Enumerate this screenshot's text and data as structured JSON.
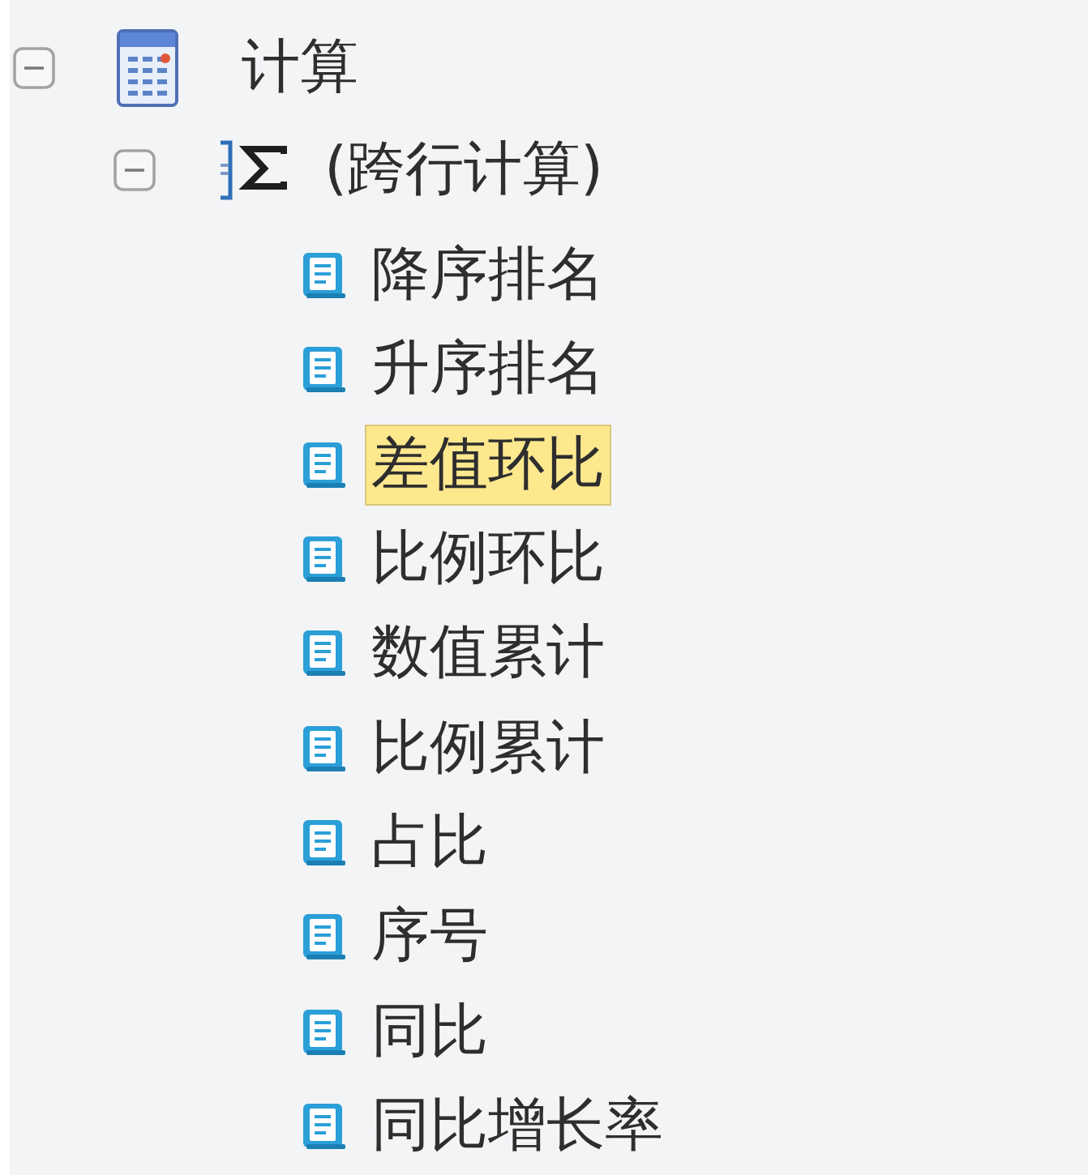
{
  "tree": [
    {
      "kind": "table",
      "label": "计算",
      "expanded": true,
      "selected": false,
      "children": [
        {
          "kind": "group",
          "label": "(跨行计算)",
          "expanded": true,
          "selected": false,
          "children": [
            {
              "kind": "field",
              "label": "降序排名",
              "selected": false
            },
            {
              "kind": "field",
              "label": "升序排名",
              "selected": false
            },
            {
              "kind": "field",
              "label": "差值环比",
              "selected": true
            },
            {
              "kind": "field",
              "label": "比例环比",
              "selected": false
            },
            {
              "kind": "field",
              "label": "数值累计",
              "selected": false
            },
            {
              "kind": "field",
              "label": "比例累计",
              "selected": false
            },
            {
              "kind": "field",
              "label": "占比",
              "selected": false
            },
            {
              "kind": "field",
              "label": "序号",
              "selected": false
            },
            {
              "kind": "field",
              "label": "同比",
              "selected": false
            },
            {
              "kind": "field",
              "label": "同比增长率",
              "selected": false
            }
          ]
        }
      ]
    }
  ]
}
